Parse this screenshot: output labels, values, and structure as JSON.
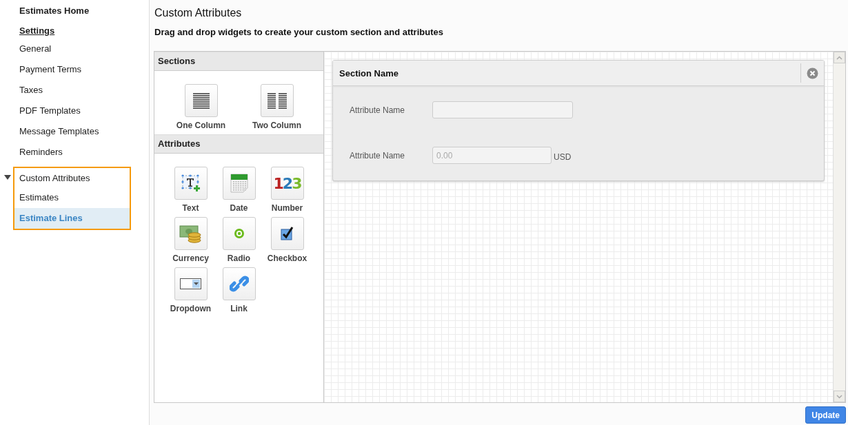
{
  "sidebar": {
    "items": [
      {
        "label": "Estimates Home",
        "kind": "heading",
        "selected": false
      },
      {
        "label": "Settings",
        "kind": "section",
        "selected": false
      },
      {
        "label": "General",
        "kind": "link",
        "selected": false
      },
      {
        "label": "Payment Terms",
        "kind": "link",
        "selected": false
      },
      {
        "label": "Taxes",
        "kind": "link",
        "selected": false
      },
      {
        "label": "PDF Templates",
        "kind": "link",
        "selected": false
      },
      {
        "label": "Message Templates",
        "kind": "link",
        "selected": false
      },
      {
        "label": "Reminders",
        "kind": "link",
        "selected": false
      },
      {
        "label": "Custom Attributes",
        "kind": "group",
        "selected": false,
        "expanded": true,
        "highlighted": true,
        "children": [
          {
            "label": "Estimates",
            "selected": false
          },
          {
            "label": "Estimate Lines",
            "selected": true
          }
        ]
      }
    ]
  },
  "page": {
    "title": "Custom Attributes",
    "subtitle": "Drag and drop widgets to create your custom section and attributes"
  },
  "palette": [
    {
      "title": "Sections",
      "widgets": [
        {
          "label": "One Column",
          "kind": "one-column"
        },
        {
          "label": "Two Column",
          "kind": "two-column"
        }
      ]
    },
    {
      "title": "Attributes",
      "widgets": [
        {
          "label": "Text",
          "kind": "text"
        },
        {
          "label": "Date",
          "kind": "date"
        },
        {
          "label": "Number",
          "kind": "number",
          "glyph": "123"
        },
        {
          "label": "Currency",
          "kind": "currency"
        },
        {
          "label": "Radio",
          "kind": "radio"
        },
        {
          "label": "Checkbox",
          "kind": "checkbox"
        },
        {
          "label": "Dropdown",
          "kind": "dropdown"
        },
        {
          "label": "Link",
          "kind": "link"
        }
      ]
    }
  ],
  "canvas": {
    "section": {
      "title": "Section Name",
      "fields": [
        {
          "label": "Attribute Name",
          "kind": "text"
        },
        {
          "label": "Attribute Name",
          "kind": "currency",
          "placeholder": "0.00",
          "suffix": "USD"
        }
      ]
    }
  },
  "buttons": [
    {
      "label": "Update"
    }
  ]
}
